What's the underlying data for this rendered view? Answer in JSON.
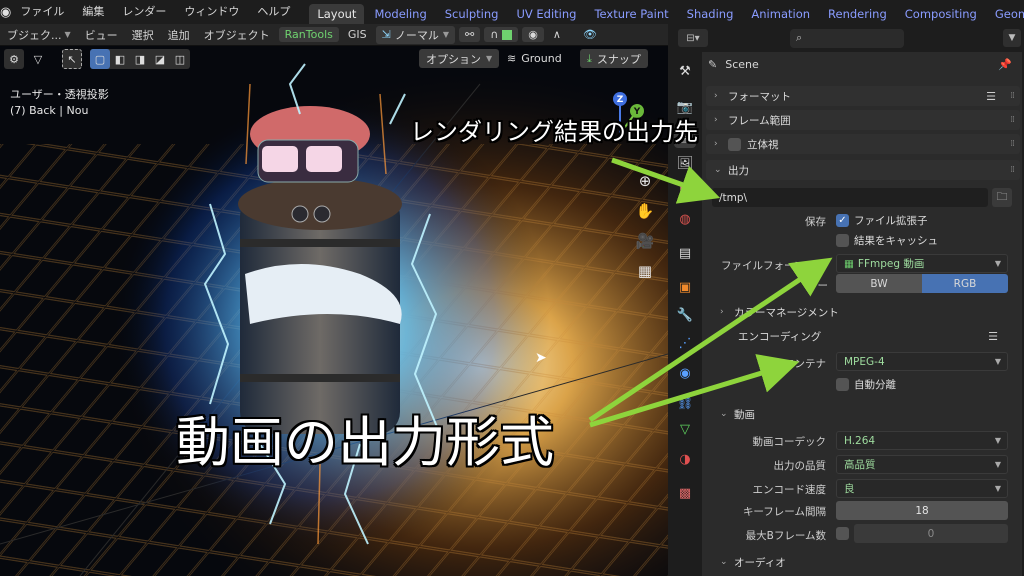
{
  "topbar": {
    "menus": [
      "ファイル",
      "編集",
      "レンダー",
      "ウィンドウ",
      "ヘルプ"
    ],
    "workspaces": [
      "Layout",
      "Modeling",
      "Sculpting",
      "UV Editing",
      "Texture Paint",
      "Shading",
      "Animation",
      "Rendering",
      "Compositing",
      "Geometry No"
    ],
    "active_workspace": "Layout"
  },
  "viewport": {
    "header": {
      "mode": "ブジェク...",
      "view": "ビュー",
      "select": "選択",
      "add": "追加",
      "object": "オブジェクト",
      "addon1": "RanTools",
      "addon2": "GIS",
      "orientation": "ノーマル"
    },
    "options_label": "オプション",
    "ground_label": "Ground",
    "snap_label": "スナップ",
    "overlay_line1": "ユーザー・透視投影",
    "overlay_line2": "(7) Back | Nou",
    "gizmo": {
      "z": "Z",
      "y": "Y"
    }
  },
  "properties": {
    "search_placeholder": "",
    "scene_label": "Scene",
    "panels": {
      "format": "フォーマット",
      "frame_range": "フレーム範囲",
      "stereoscopy": "立体視",
      "output": "出力",
      "color_management": "カラーマネージメント",
      "encoding": "エンコーディング",
      "video": "動画",
      "audio": "オーディオ"
    },
    "output_path": "/tmp\\",
    "save_label": "保存",
    "file_extension_label": "ファイル拡張子",
    "file_extension_checked": true,
    "cache_result_label": "結果をキャッシュ",
    "cache_result_checked": false,
    "file_format_label": "ファイルフォーマット",
    "file_format_value": "FFmpeg 動画",
    "color_label": "ー",
    "color_modes": [
      "BW",
      "RGB"
    ],
    "color_mode_selected": "RGB",
    "container_label": "コンテナ",
    "container_value": "MPEG-4",
    "autosplit_label": "自動分離",
    "autosplit_checked": false,
    "video_codec_label": "動画コーデック",
    "video_codec_value": "H.264",
    "output_quality_label": "出力の品質",
    "output_quality_value": "高品質",
    "encoding_speed_label": "エンコード速度",
    "encoding_speed_value": "良",
    "keyframe_interval_label": "キーフレーム間隔",
    "keyframe_interval_value": "18",
    "max_bframes_label": "最大Bフレーム数",
    "max_bframes_checked": false,
    "max_bframes_value": "0"
  },
  "annotations": {
    "render_output_dest": "レンダリング結果の出力先",
    "video_output_format": "動画の出力形式"
  },
  "colors": {
    "accent_blue": "#4772b3",
    "workspace_tab_text": "#8a9cff",
    "arrow_green": "#8ed43c",
    "dropdown_text": "#9edb9e"
  }
}
